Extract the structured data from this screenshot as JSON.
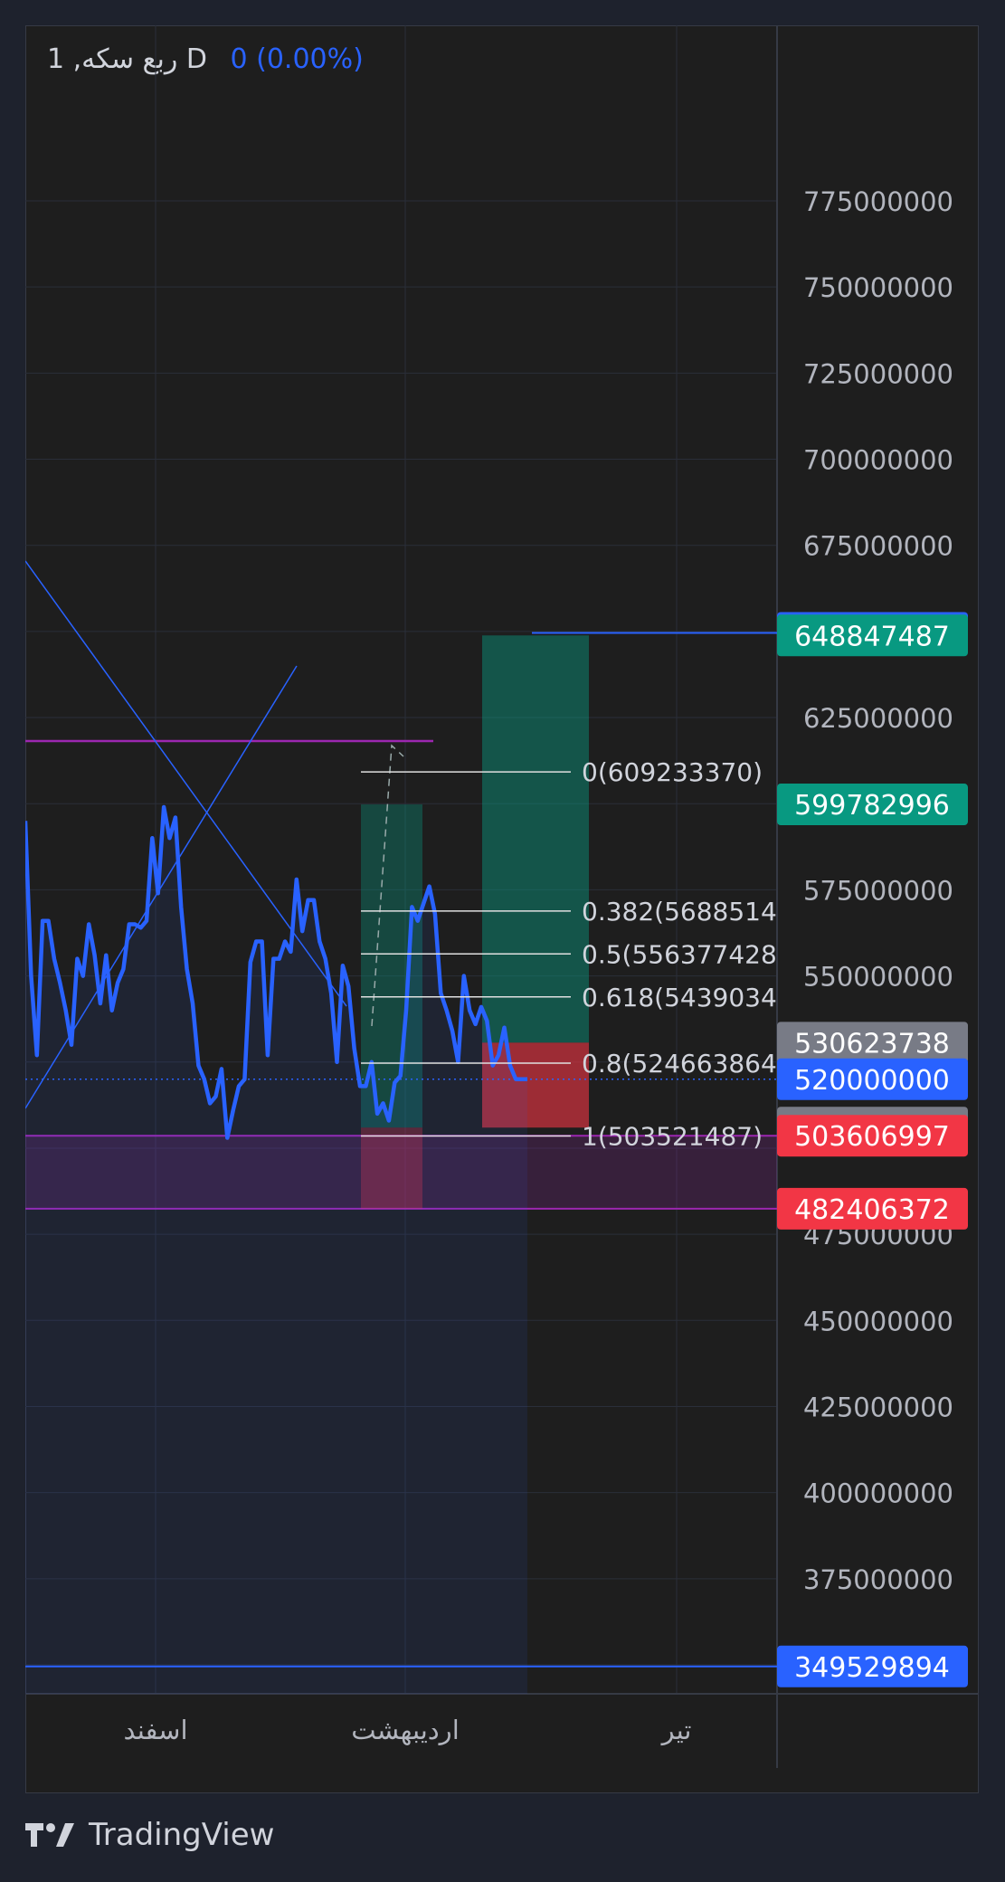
{
  "legend": {
    "symbol": "1 ,ربع سکه D",
    "change": "0 (0.00%)"
  },
  "brand": {
    "name": "TradingView"
  },
  "colors": {
    "line": "#2962ff",
    "grid": "#2a2e39",
    "text": "#b2b5be",
    "purple": "#9c27b0",
    "profit": "#089981",
    "loss": "#f23645",
    "gray_label": "#787b86"
  },
  "chart_data": {
    "type": "line",
    "x_labels": [
      "اسفند",
      "اردیبهشت",
      "تیر"
    ],
    "y_ticks": [
      775000000,
      750000000,
      725000000,
      700000000,
      675000000,
      625000000,
      575000000,
      550000000,
      475000000,
      450000000,
      425000000,
      400000000,
      375000000
    ],
    "ylim": [
      335000000,
      795000000
    ],
    "series": [
      {
        "values": [
          595000000,
          550000000,
          527000000,
          566000000,
          566000000,
          555000000,
          548000000,
          540000000,
          530000000,
          555000000,
          550000000,
          565000000,
          556000000,
          542000000,
          556000000,
          540000000,
          548000000,
          552000000,
          565000000,
          565000000,
          564000000,
          566000000,
          590000000,
          574000000,
          599000000,
          590000000,
          596000000,
          570000000,
          552000000,
          542000000,
          524000000,
          520000000,
          513000000,
          515000000,
          523000000,
          503000000,
          511000000,
          518000000,
          520000000,
          554000000,
          560000000,
          560000000,
          527000000,
          555000000,
          555000000,
          560000000,
          557000000,
          578000000,
          563000000,
          572000000,
          572000000,
          560000000,
          555000000,
          545000000,
          525000000,
          553000000,
          547000000,
          529000000,
          518000000,
          518000000,
          525000000,
          510000000,
          513000000,
          508000000,
          519000000,
          521000000,
          540000000,
          570000000,
          566000000,
          571000000,
          576000000,
          568000000,
          545000000,
          540000000,
          534000000,
          525000000,
          550000000,
          540000000,
          536000000,
          541000000,
          537000000,
          524000000,
          527000000,
          535000000,
          524000000,
          520000000,
          520000000,
          520000000
        ]
      }
    ],
    "current_price": 520000000,
    "price_labels": [
      {
        "value": 649576070,
        "text": "649576070",
        "color": "#2962ff"
      },
      {
        "value": 648847487,
        "text": "648847487",
        "color": "#089981"
      },
      {
        "value": 599782996,
        "text": "599782996",
        "color": "#089981"
      },
      {
        "value": 530623738,
        "text": "530623738",
        "color": "#787b86"
      },
      {
        "value": 520000000,
        "text": "520000000",
        "color": "#2962ff"
      },
      {
        "value": 505966431,
        "text": "505966431",
        "color": "#787b86"
      },
      {
        "value": 503606997,
        "text": "503606997",
        "color": "#f23645"
      },
      {
        "value": 482406372,
        "text": "482406372",
        "color": "#f23645"
      },
      {
        "value": 349529894,
        "text": "349529894",
        "color": "#2962ff"
      }
    ],
    "fib_levels": [
      {
        "value": 609233370,
        "text": "0(609233370)"
      },
      {
        "value": 568851400,
        "text": "0.382(5688514"
      },
      {
        "value": 556377428,
        "text": "0.5(556377428"
      },
      {
        "value": 543903400,
        "text": "0.618(5439034"
      },
      {
        "value": 524663864,
        "text": "0.8(524663864"
      },
      {
        "value": 503521487,
        "text": "1(503521487)"
      }
    ],
    "horizontal_lines": [
      649576070,
      599782996,
      349529894
    ],
    "zone": [
      482406372,
      503606997
    ],
    "position_long": {
      "entry": 530623738,
      "target": 648847487,
      "stop": 505966431
    },
    "position_small": {
      "target": 599782996,
      "entry": 505966431,
      "stop": 482406372
    }
  }
}
